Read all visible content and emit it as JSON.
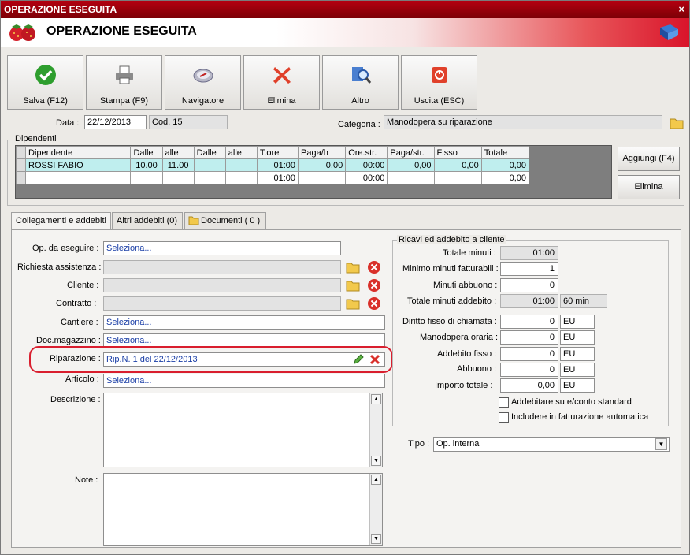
{
  "window": {
    "title": "OPERAZIONE ESEGUITA",
    "close": "×"
  },
  "header": {
    "title": "OPERAZIONE ESEGUITA"
  },
  "toolbar": [
    {
      "label": "Salva (F12)",
      "icon": "check-icon"
    },
    {
      "label": "Stampa (F9)",
      "icon": "printer-icon"
    },
    {
      "label": "Navigatore",
      "icon": "compass-icon"
    },
    {
      "label": "Elimina",
      "icon": "delete-x-icon"
    },
    {
      "label": "Altro",
      "icon": "search-doc-icon"
    },
    {
      "label": "Uscita (ESC)",
      "icon": "exit-icon"
    }
  ],
  "top": {
    "data_label": "Data :",
    "data_value": "22/12/2013",
    "cod": "Cod. 15",
    "categoria_label": "Categoria :",
    "categoria_value": "Manodopera su riparazione"
  },
  "dipendenti": {
    "group": "Dipendenti",
    "columns": [
      "Dipendente",
      "Dalle",
      "alle",
      "Dalle",
      "alle",
      "T.ore",
      "Paga/h",
      "Ore.str.",
      "Paga/str.",
      "Fisso",
      "Totale"
    ],
    "rows": [
      [
        "ROSSI FABIO",
        "10.00",
        "11.00",
        "",
        "",
        "01:00",
        "0,00",
        "00:00",
        "0,00",
        "0,00",
        "0,00"
      ],
      [
        "",
        "",
        "",
        "",
        "",
        "01:00",
        "",
        "00:00",
        "",
        "",
        "0,00"
      ]
    ],
    "add_button": "Aggiungi (F4)",
    "delete_button": "Elimina"
  },
  "tabs": [
    "Collegamenti e addebiti",
    "Altri addebiti (0)",
    "Documenti ( 0 )"
  ],
  "form": {
    "op_label": "Op. da eseguire :",
    "op_value": "Seleziona...",
    "richiesta_label": "Richiesta assistenza :",
    "cliente_label": "Cliente :",
    "contratto_label": "Contratto :",
    "cantiere_label": "Cantiere :",
    "cantiere_value": "Seleziona...",
    "docmag_label": "Doc.magazzino :",
    "docmag_value": "Seleziona...",
    "riparazione_label": "Riparazione :",
    "riparazione_value": "Rip.N. 1 del 22/12/2013",
    "articolo_label": "Articolo :",
    "articolo_value": "Seleziona...",
    "descrizione_label": "Descrizione :",
    "note_label": "Note :"
  },
  "ricavi": {
    "group": "Ricavi ed addebito a cliente",
    "totale_minuti_label": "Totale minuti :",
    "totale_minuti": "01:00",
    "minimo_label": "Minimo minuti fatturabili :",
    "minimo": "1",
    "abbuono_min_label": "Minuti abbuono :",
    "abbuono_min": "0",
    "tot_addebito_label": "Totale minuti addebito :",
    "tot_addebito": "01:00",
    "tot_addebito_min": "60 min",
    "diritto_label": "Diritto fisso di chiamata :",
    "diritto": "0",
    "manodopera_label": "Manodopera oraria :",
    "manodopera": "0",
    "addebito_fisso_label": "Addebito fisso :",
    "addebito_fisso": "0",
    "abbuono_label": "Abbuono :",
    "abbuono": "0",
    "importo_label": "Importo totale :",
    "importo": "0,00",
    "currency": "EU",
    "chk1": "Addebitare su e/conto standard",
    "chk2": "Includere in fatturazione automatica",
    "tipo_label": "Tipo :",
    "tipo_value": "Op. interna"
  }
}
